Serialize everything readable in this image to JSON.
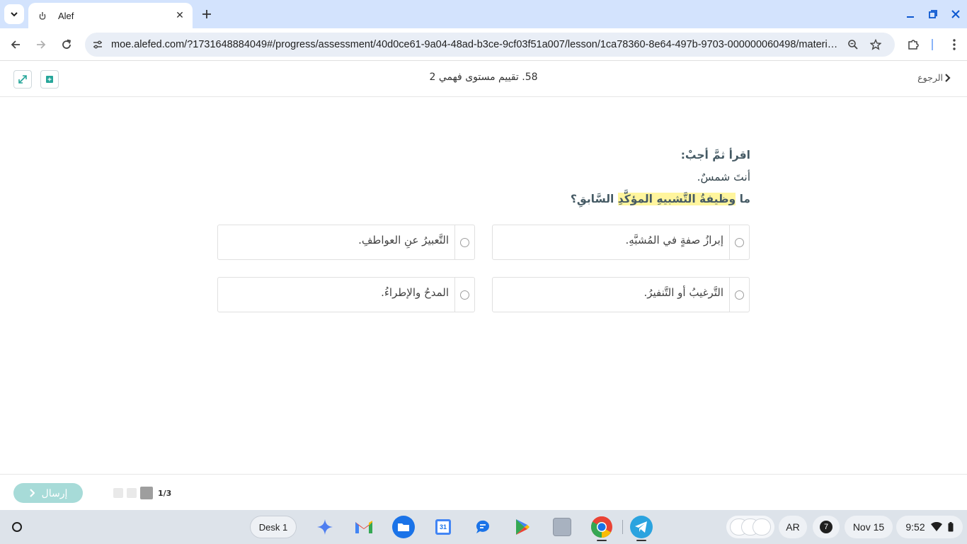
{
  "browser": {
    "tab_title": "Alef",
    "url": "moe.alefed.com/?1731648884049#/progress/assessment/40d0ce61-9a04-48ad-b3ce-9cf03f51a007/lesson/1ca78360-8e64-497b-9703-000000060498/material/..."
  },
  "header": {
    "title": "58. تقييم مستوى فهمي 2",
    "back_label": "الرجوع"
  },
  "question": {
    "instruction": "اقرأ ثمَّ أجبْ:",
    "sentence": "أنتَ شمسٌ.",
    "prompt_prefix": "ما ",
    "prompt_highlight": "وظيفةُ التَّشبيهِ المؤكَّدِ",
    "prompt_suffix": " السَّابقِ؟"
  },
  "answers": [
    {
      "text": "إبرازُ صفةٍ في المُشبَّهِ."
    },
    {
      "text": "التَّعبيرُ عنِ العواطفِ."
    },
    {
      "text": "التَّرغيبُ أو التَّنفيرُ."
    },
    {
      "text": "المدحُ والإطراءُ."
    }
  ],
  "footer": {
    "submit_label": "إرسال",
    "page_indicator": "1/3"
  },
  "shelf": {
    "desk_label": "Desk 1",
    "calendar_day": "31",
    "ime": "AR",
    "notification_count": "7",
    "date": "Nov 15",
    "time": "9:52"
  },
  "colors": {
    "accent_teal": "#a7dbd8",
    "highlight": "#fff59d",
    "tabstrip": "#d3e3fd"
  }
}
